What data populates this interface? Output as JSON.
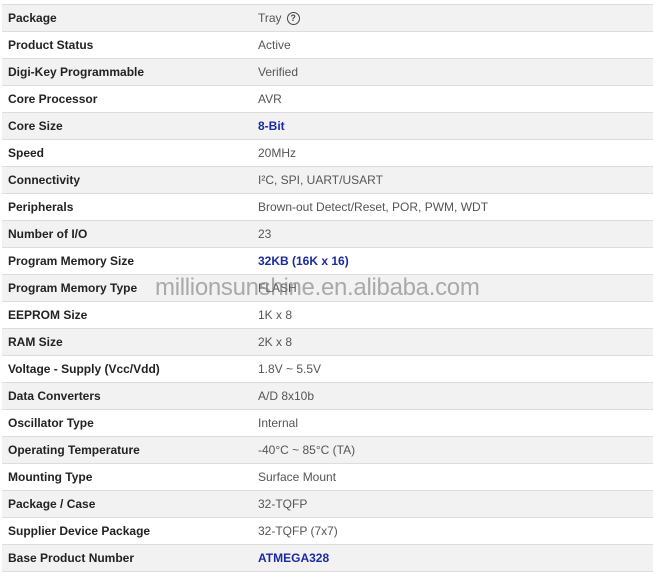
{
  "rows": [
    {
      "label": "Package",
      "value": "Tray",
      "help": true
    },
    {
      "label": "Product Status",
      "value": "Active"
    },
    {
      "label": "Digi-Key Programmable",
      "value": "Verified"
    },
    {
      "label": "Core Processor",
      "value": "AVR"
    },
    {
      "label": "Core Size",
      "value": "8-Bit",
      "link": true
    },
    {
      "label": "Speed",
      "value": "20MHz"
    },
    {
      "label": "Connectivity",
      "value": "I²C, SPI, UART/USART"
    },
    {
      "label": "Peripherals",
      "value": "Brown-out Detect/Reset, POR, PWM, WDT"
    },
    {
      "label": "Number of I/O",
      "value": "23"
    },
    {
      "label": "Program Memory Size",
      "value": "32KB (16K x 16)",
      "link": true
    },
    {
      "label": "Program Memory Type",
      "value": "FLASH"
    },
    {
      "label": "EEPROM Size",
      "value": "1K x 8"
    },
    {
      "label": "RAM Size",
      "value": "2K x 8"
    },
    {
      "label": "Voltage - Supply (Vcc/Vdd)",
      "value": "1.8V ~ 5.5V"
    },
    {
      "label": "Data Converters",
      "value": "A/D 8x10b"
    },
    {
      "label": "Oscillator Type",
      "value": "Internal"
    },
    {
      "label": "Operating Temperature",
      "value": "-40°C ~ 85°C (TA)"
    },
    {
      "label": "Mounting Type",
      "value": "Surface Mount"
    },
    {
      "label": "Package / Case",
      "value": "32-TQFP"
    },
    {
      "label": "Supplier Device Package",
      "value": "32-TQFP (7x7)"
    },
    {
      "label": "Base Product Number",
      "value": "ATMEGA328",
      "link": true
    }
  ],
  "help_icon": "?",
  "watermark": "millionsunshine.en.alibaba.com",
  "colors": {
    "link": "#1a2aa0",
    "stripe": "#f2f2f2"
  }
}
